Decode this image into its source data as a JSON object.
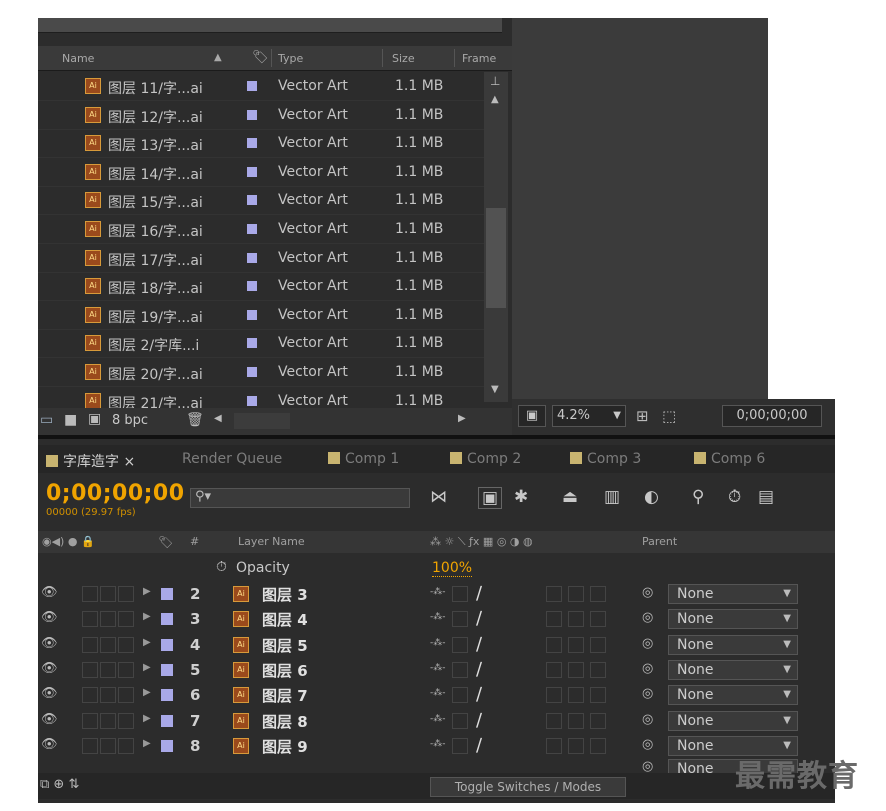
{
  "project": {
    "columns": {
      "name": "Name",
      "type": "Type",
      "size": "Size",
      "frame": "Frame"
    },
    "rows": [
      {
        "name": "图层 11/字...ai",
        "type": "Vector Art",
        "size": "1.1 MB"
      },
      {
        "name": "图层 12/字...ai",
        "type": "Vector Art",
        "size": "1.1 MB"
      },
      {
        "name": "图层 13/字...ai",
        "type": "Vector Art",
        "size": "1.1 MB"
      },
      {
        "name": "图层 14/字...ai",
        "type": "Vector Art",
        "size": "1.1 MB"
      },
      {
        "name": "图层 15/字...ai",
        "type": "Vector Art",
        "size": "1.1 MB"
      },
      {
        "name": "图层 16/字...ai",
        "type": "Vector Art",
        "size": "1.1 MB"
      },
      {
        "name": "图层 17/字...ai",
        "type": "Vector Art",
        "size": "1.1 MB"
      },
      {
        "name": "图层 18/字...ai",
        "type": "Vector Art",
        "size": "1.1 MB"
      },
      {
        "name": "图层 19/字...ai",
        "type": "Vector Art",
        "size": "1.1 MB"
      },
      {
        "name": "图层 2/字库...i",
        "type": "Vector Art",
        "size": "1.1 MB"
      },
      {
        "name": "图层 20/字...ai",
        "type": "Vector Art",
        "size": "1.1 MB"
      },
      {
        "name": "图层 21/字...ai",
        "type": "Vector Art",
        "size": "1.1 MB"
      }
    ],
    "bpc": "8 bpc"
  },
  "viewer": {
    "zoom": "4.2%",
    "timecode": "0;00;00;00"
  },
  "timeline": {
    "tabs": [
      {
        "label": "字库造字 ×",
        "color": "#c8b470"
      },
      {
        "label": "Render Queue"
      },
      {
        "label": "Comp 1",
        "color": "#c8b470"
      },
      {
        "label": "Comp 2",
        "color": "#c8b470"
      },
      {
        "label": "Comp 3",
        "color": "#c8b470"
      },
      {
        "label": "Comp 6",
        "color": "#c8b470"
      }
    ],
    "timecode": "0;00;00;00",
    "fps": "00000 (29.97 fps)",
    "header": {
      "hash": "#",
      "layer_name": "Layer Name",
      "parent": "Parent"
    },
    "opacity_label": "Opacity",
    "opacity_value": "100%",
    "layers": [
      {
        "num": "2",
        "name": "图层 3",
        "parent": "None"
      },
      {
        "num": "3",
        "name": "图层 4",
        "parent": "None"
      },
      {
        "num": "4",
        "name": "图层 5",
        "parent": "None"
      },
      {
        "num": "5",
        "name": "图层 6",
        "parent": "None"
      },
      {
        "num": "6",
        "name": "图层 7",
        "parent": "None"
      },
      {
        "num": "7",
        "name": "图层 8",
        "parent": "None"
      },
      {
        "num": "8",
        "name": "图层 9",
        "parent": "None"
      }
    ],
    "toggle_label": "Toggle Switches / Modes",
    "last_parent": "None"
  },
  "watermark": "最需教育",
  "colors": {
    "accent": "#f0a400",
    "layer_label": "#a9a9e8",
    "panel": "#2c2c2c"
  }
}
